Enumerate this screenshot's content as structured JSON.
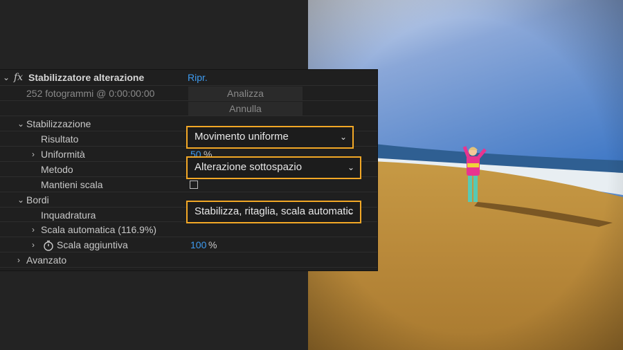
{
  "effect": {
    "fx_label": "fx",
    "name": "Stabilizzatore alterazione",
    "reset": "Ripr.",
    "frames_info": "252 fotogrammi @ 0:00:00:00",
    "analyze_button": "Analizza",
    "cancel_button": "Annulla"
  },
  "stabilization": {
    "label": "Stabilizzazione",
    "result_label": "Risultato",
    "result_value": "Movimento uniforme",
    "smoothness_label": "Uniformità",
    "smoothness_value": "50",
    "smoothness_unit": "%",
    "method_label": "Metodo",
    "method_value": "Alterazione sottospazio",
    "preserve_scale_label": "Mantieni scala",
    "preserve_scale_checked": false
  },
  "borders": {
    "label": "Bordi",
    "framing_label": "Inquadratura",
    "framing_value": "Stabilizza, ritaglia, scala automatic",
    "auto_scale_label": "Scala automatica (116.9%)",
    "additional_scale_label": "Scala aggiuntiva",
    "additional_scale_value": "100",
    "additional_scale_unit": "%"
  },
  "advanced": {
    "label": "Avanzato"
  },
  "icons": {
    "expand": "chevron-down-icon",
    "collapse": "chevron-right-icon",
    "stopwatch": "stopwatch-icon",
    "dropdown": "dropdown-arrow-icon"
  },
  "colors": {
    "highlight": "#f3a826",
    "value_blue": "#3e9bf0",
    "panel_bg": "#1f1f1f",
    "app_bg": "#232323"
  }
}
